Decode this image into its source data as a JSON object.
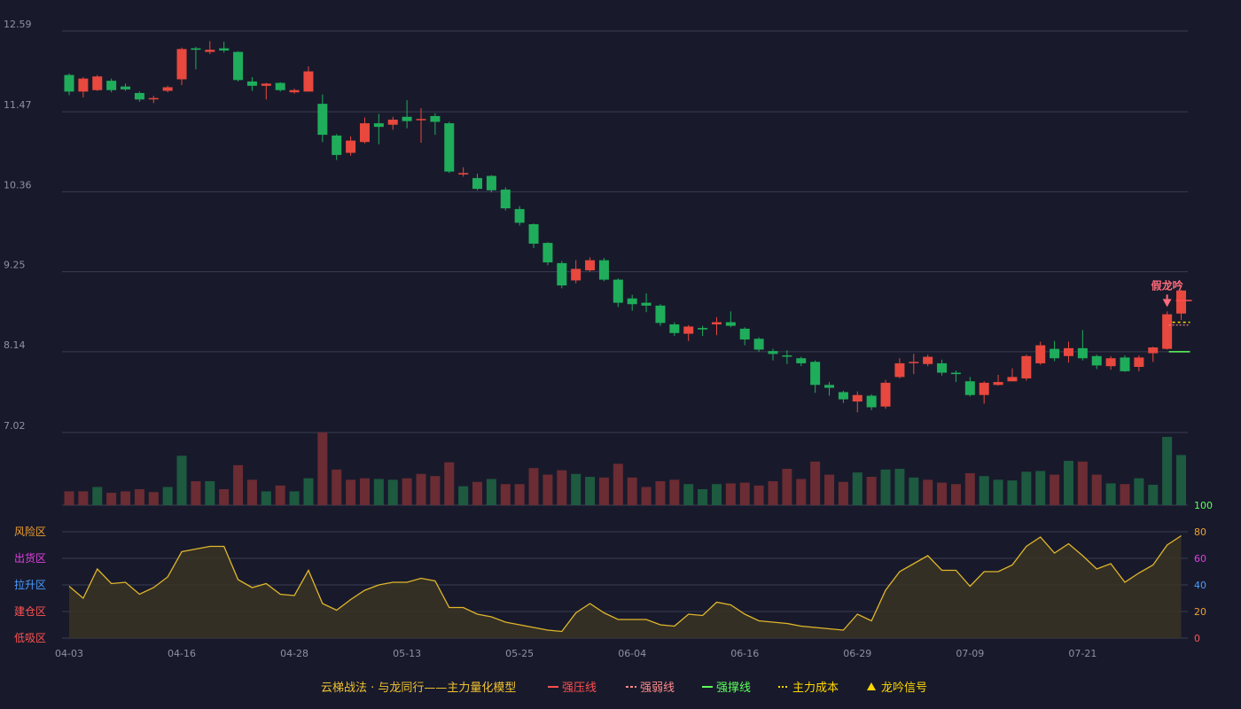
{
  "colors": {
    "background": "#181a2b",
    "grid": "#3a3d52",
    "up": "#e8483e",
    "down": "#1fad5b",
    "vol_up": "#6b2c33",
    "vol_down": "#1d5a40",
    "osc_line": "#e0b62a",
    "strong_pressure": "#ff4d4d",
    "weak_pressure": "#ff8a8a",
    "support": "#5dff5d",
    "main_cost": "#ffd700",
    "signal": "#ffd700"
  },
  "chart_data": {
    "type": "candlestick",
    "price_axis": {
      "ticks": [
        "12.59",
        "11.47",
        "10.36",
        "9.25",
        "8.14",
        "7.02"
      ],
      "ylim": [
        7.02,
        12.59
      ]
    },
    "x_ticks": [
      {
        "index": 0,
        "label": "04-03"
      },
      {
        "index": 8,
        "label": "04-16"
      },
      {
        "index": 16,
        "label": "04-28"
      },
      {
        "index": 24,
        "label": "05-13"
      },
      {
        "index": 32,
        "label": "05-25"
      },
      {
        "index": 40,
        "label": "06-04"
      },
      {
        "index": 48,
        "label": "06-16"
      },
      {
        "index": 56,
        "label": "06-29"
      },
      {
        "index": 64,
        "label": "07-09"
      },
      {
        "index": 72,
        "label": "07-21"
      }
    ],
    "candles": [
      [
        11.98,
        11.75,
        12.0,
        11.7
      ],
      [
        11.75,
        11.93,
        11.95,
        11.67
      ],
      [
        11.77,
        11.96,
        11.98,
        11.76
      ],
      [
        11.9,
        11.77,
        11.93,
        11.74
      ],
      [
        11.82,
        11.78,
        11.86,
        11.76
      ],
      [
        11.73,
        11.64,
        11.75,
        11.61
      ],
      [
        11.66,
        11.66,
        11.69,
        11.59
      ],
      [
        11.76,
        11.81,
        11.83,
        11.74
      ],
      [
        11.92,
        12.34,
        12.36,
        11.84
      ],
      [
        12.35,
        12.33,
        12.37,
        12.06
      ],
      [
        12.3,
        12.33,
        12.45,
        12.27
      ],
      [
        12.35,
        12.32,
        12.44,
        12.29
      ],
      [
        12.3,
        11.91,
        12.31,
        11.89
      ],
      [
        11.89,
        11.83,
        11.95,
        11.76
      ],
      [
        11.83,
        11.86,
        11.87,
        11.64
      ],
      [
        11.87,
        11.77,
        11.88,
        11.75
      ],
      [
        11.74,
        11.77,
        11.79,
        11.72
      ],
      [
        11.75,
        12.03,
        12.1,
        11.75
      ],
      [
        11.58,
        11.15,
        11.71,
        11.05
      ],
      [
        11.14,
        10.87,
        11.16,
        10.8
      ],
      [
        10.9,
        11.07,
        11.13,
        10.86
      ],
      [
        11.05,
        11.31,
        11.39,
        11.03
      ],
      [
        11.31,
        11.26,
        11.44,
        11.02
      ],
      [
        11.29,
        11.36,
        11.4,
        11.22
      ],
      [
        11.4,
        11.34,
        11.63,
        11.24
      ],
      [
        11.37,
        11.37,
        11.52,
        11.04
      ],
      [
        11.41,
        11.33,
        11.45,
        11.15
      ],
      [
        11.31,
        10.64,
        11.33,
        10.62
      ],
      [
        10.6,
        10.62,
        10.7,
        10.57
      ],
      [
        10.55,
        10.4,
        10.61,
        10.38
      ],
      [
        10.58,
        10.38,
        10.59,
        10.35
      ],
      [
        10.39,
        10.13,
        10.42,
        10.1
      ],
      [
        10.12,
        9.93,
        10.16,
        9.89
      ],
      [
        9.91,
        9.64,
        9.92,
        9.58
      ],
      [
        9.65,
        9.38,
        9.66,
        9.34
      ],
      [
        9.37,
        9.06,
        9.4,
        9.02
      ],
      [
        9.13,
        9.29,
        9.41,
        9.09
      ],
      [
        9.27,
        9.41,
        9.45,
        9.25
      ],
      [
        9.41,
        9.14,
        9.44,
        9.12
      ],
      [
        9.14,
        8.82,
        9.16,
        8.76
      ],
      [
        8.88,
        8.8,
        8.93,
        8.71
      ],
      [
        8.82,
        8.78,
        8.95,
        8.69
      ],
      [
        8.78,
        8.54,
        8.8,
        8.5
      ],
      [
        8.52,
        8.4,
        8.55,
        8.36
      ],
      [
        8.39,
        8.49,
        8.51,
        8.29
      ],
      [
        8.47,
        8.45,
        8.5,
        8.36
      ],
      [
        8.52,
        8.55,
        8.62,
        8.37
      ],
      [
        8.55,
        8.5,
        8.7,
        8.48
      ],
      [
        8.46,
        8.31,
        8.48,
        8.23
      ],
      [
        8.32,
        8.17,
        8.34,
        8.14
      ],
      [
        8.15,
        8.11,
        8.18,
        8.02
      ],
      [
        8.09,
        8.08,
        8.16,
        7.97
      ],
      [
        8.05,
        7.98,
        8.07,
        7.94
      ],
      [
        8.0,
        7.68,
        8.02,
        7.57
      ],
      [
        7.68,
        7.64,
        7.72,
        7.53
      ],
      [
        7.58,
        7.48,
        7.6,
        7.43
      ],
      [
        7.45,
        7.54,
        7.59,
        7.3
      ],
      [
        7.53,
        7.37,
        7.55,
        7.33
      ],
      [
        7.38,
        7.71,
        7.75,
        7.35
      ],
      [
        7.79,
        7.98,
        8.05,
        7.77
      ],
      [
        8.0,
        8.0,
        8.11,
        7.83
      ],
      [
        7.97,
        8.07,
        8.1,
        7.94
      ],
      [
        7.98,
        7.85,
        8.03,
        7.81
      ],
      [
        7.85,
        7.83,
        7.88,
        7.72
      ],
      [
        7.73,
        7.54,
        7.79,
        7.52
      ],
      [
        7.54,
        7.71,
        7.73,
        7.42
      ],
      [
        7.68,
        7.72,
        7.82,
        7.67
      ],
      [
        7.73,
        7.79,
        7.91,
        7.73
      ],
      [
        7.77,
        8.08,
        8.1,
        7.74
      ],
      [
        7.98,
        8.23,
        8.28,
        7.96
      ],
      [
        8.18,
        8.05,
        8.29,
        8.01
      ],
      [
        8.08,
        8.19,
        8.28,
        7.99
      ],
      [
        8.19,
        8.05,
        8.44,
        8.02
      ],
      [
        8.08,
        7.95,
        8.1,
        7.9
      ],
      [
        7.94,
        8.05,
        8.08,
        7.89
      ],
      [
        8.06,
        7.87,
        8.09,
        7.86
      ],
      [
        7.93,
        8.06,
        8.09,
        7.87
      ],
      [
        8.12,
        8.2,
        8.21,
        8.0
      ],
      [
        8.18,
        8.66,
        8.7,
        8.17
      ],
      [
        8.67,
        8.99,
        9.0,
        8.58
      ]
    ],
    "volume_axis": {
      "ticks": [
        "100"
      ]
    },
    "volumes": [
      19,
      19,
      25,
      17,
      19,
      22,
      18,
      25,
      68,
      33,
      33,
      22,
      55,
      35,
      19,
      27,
      19,
      37,
      100,
      49,
      35,
      37,
      36,
      35,
      37,
      43,
      40,
      59,
      26,
      32,
      36,
      29,
      29,
      51,
      42,
      48,
      43,
      39,
      38,
      57,
      38,
      25,
      33,
      35,
      29,
      22,
      29,
      30,
      31,
      27,
      33,
      50,
      36,
      60,
      42,
      32,
      45,
      39,
      49,
      50,
      38,
      35,
      31,
      29,
      44,
      40,
      35,
      34,
      46,
      47,
      42,
      61,
      60,
      42,
      30,
      29,
      37,
      28,
      94,
      69
    ],
    "volume_is_up": [
      true,
      true,
      false,
      true,
      true,
      true,
      true,
      false,
      false,
      true,
      false,
      true,
      true,
      true,
      false,
      true,
      false,
      false,
      true,
      true,
      true,
      true,
      false,
      false,
      true,
      true,
      true,
      true,
      false,
      true,
      false,
      true,
      true,
      true,
      true,
      true,
      false,
      false,
      true,
      true,
      true,
      true,
      true,
      true,
      false,
      false,
      false,
      true,
      true,
      true,
      true,
      true,
      true,
      true,
      true,
      true,
      false,
      true,
      false,
      false,
      false,
      true,
      true,
      true,
      true,
      false,
      false,
      false,
      false,
      false,
      true,
      false,
      true,
      true,
      false,
      true,
      false,
      false,
      false,
      false
    ],
    "oscillator": {
      "ticks": [
        "80",
        "60",
        "40",
        "20",
        "0"
      ],
      "zone_labels": [
        "风险区",
        "出货区",
        "拉升区",
        "建仓区",
        "低吸区"
      ],
      "ylim": [
        0,
        80
      ],
      "values": [
        39,
        30,
        52,
        41,
        42,
        33,
        38,
        46,
        65,
        67,
        69,
        69,
        44,
        38,
        41,
        33,
        32,
        51,
        26,
        21,
        29,
        36,
        40,
        42,
        42,
        45,
        43,
        23,
        23,
        18,
        16,
        12,
        10,
        8,
        6,
        5,
        19,
        26,
        19,
        14,
        14,
        14,
        10,
        9,
        18,
        17,
        27,
        25,
        18,
        13,
        12,
        11,
        9,
        8,
        7,
        6,
        18,
        13,
        36,
        50,
        56,
        62,
        51,
        51,
        39,
        50,
        50,
        55,
        69,
        76,
        64,
        71,
        62,
        52,
        56,
        42,
        49,
        55,
        70,
        77
      ]
    },
    "signal_label": "假龙吟",
    "overlays": {
      "strong_pressure": 8.85,
      "weak_pressure": 8.51,
      "support": 8.14,
      "main_cost": 8.55
    },
    "legend": [
      {
        "key": "model",
        "label": "云梯战法 · 与龙同行——主力量化模型",
        "color": "#f0c030"
      },
      {
        "key": "strong_pressure",
        "label": "强压线",
        "color": "#ff4d4d",
        "style": "solid"
      },
      {
        "key": "weak_pressure",
        "label": "强弱线",
        "color": "#ff8a8a",
        "style": "dashed"
      },
      {
        "key": "support",
        "label": "强撑线",
        "color": "#5dff5d",
        "style": "solid"
      },
      {
        "key": "main_cost",
        "label": "主力成本",
        "color": "#ffd700",
        "style": "dotted"
      },
      {
        "key": "signal",
        "label": "龙吟信号",
        "color": "#ffd700",
        "style": "triangle"
      }
    ]
  }
}
